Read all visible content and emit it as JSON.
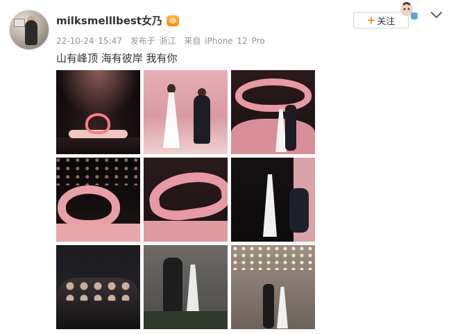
{
  "post": {
    "username": "milksmelllbest女乃",
    "meta": {
      "date": "22-10-24 15:47",
      "posted_in": "发布于 浙江",
      "source": "来自 iPhone 12 Pro"
    },
    "text": "山有峰顶 海有彼岸 我有你",
    "actions": {
      "follow_label": "关注",
      "follow_plus": "+"
    },
    "photos": [
      {
        "label": "photo-1"
      },
      {
        "label": "photo-2"
      },
      {
        "label": "photo-3"
      },
      {
        "label": "photo-4"
      },
      {
        "label": "photo-5"
      },
      {
        "label": "photo-6"
      },
      {
        "label": "photo-7"
      },
      {
        "label": "photo-8"
      },
      {
        "label": "photo-9"
      }
    ],
    "icons": {
      "vip_badge": "vip-badge-icon",
      "chevron": "chevron-down-icon",
      "sticker": "sticker-icon"
    },
    "colors": {
      "accent": "#ff8200",
      "meta_text": "#939393",
      "primary_text": "#333333"
    }
  }
}
